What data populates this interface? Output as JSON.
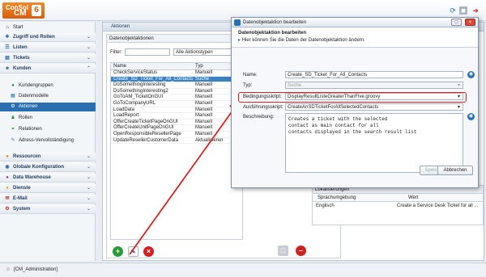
{
  "brand": {
    "line1": "ConSol",
    "line2": "CM",
    "version": "6"
  },
  "sidebar": {
    "start": "Start",
    "sections": [
      {
        "label": "Zugriff und Rollen"
      },
      {
        "label": "Listen"
      },
      {
        "label": "Tickets"
      },
      {
        "label": "Kunden"
      }
    ],
    "kunden_items": [
      "Kundengruppen",
      "Datenmodelle",
      "Aktionen",
      "Rollen",
      "Relationen",
      "Adress-Vervollständigung"
    ],
    "lower": [
      {
        "label": "Ressourcen"
      },
      {
        "label": "Globale Konfiguration"
      },
      {
        "label": "Data Warehouse"
      },
      {
        "label": "Dienste"
      },
      {
        "label": "E-Mail"
      },
      {
        "label": "System"
      }
    ]
  },
  "panel": {
    "title": "Aktionen",
    "inner_title": "Datenobjektaktionen",
    "filter_label": "Filter:",
    "filter_value": "",
    "type_select": "Alle Aktionstypen",
    "col_name": "Name",
    "col_typ": "Typ",
    "rows": [
      {
        "name": "CheckServiceStatus",
        "typ": "Manuell"
      },
      {
        "name": "Create_SD_Ticket_For_All_Contacts",
        "typ": "Suche"
      },
      {
        "name": "DoSomethingInteresting",
        "typ": "Manuell"
      },
      {
        "name": "DoSomethingInteresting2",
        "typ": "Manuell"
      },
      {
        "name": "GoToAM_TicketOnGUI",
        "typ": "Manuell"
      },
      {
        "name": "GoToCompanyURL",
        "typ": "Manuell"
      },
      {
        "name": "LoadData",
        "typ": "Manuell"
      },
      {
        "name": "LoadReport",
        "typ": "Manuell"
      },
      {
        "name": "OfferCreateTicketPageOnGUI",
        "typ": "Manuell"
      },
      {
        "name": "OfferCreateUnitPageOnGUI",
        "typ": "Manuell"
      },
      {
        "name": "OpenResponsibleResellerPage",
        "typ": "Manuell"
      },
      {
        "name": "UpdateResellerCustomerData",
        "typ": "Aktualisieren"
      }
    ],
    "selected_index": 1
  },
  "dialog": {
    "title": "Datenobjektaktion bearbeiten",
    "heading": "Datenobjektaktion bearbeiten",
    "info": "Hier können Sie die Daten der Datenobjektaktion ändern.",
    "name_label": "Name:",
    "name_value": "Create_SD_Ticket_For_All_Contacts",
    "typ_label": "Typ:",
    "typ_value": "Suche",
    "cond_label": "Bedingungsskript:",
    "cond_value": "DisplayResultListeGreaterThanFive.groovy",
    "exec_label": "Ausführungsskript:",
    "exec_value": "CreateAnSDTicketForAllSelectedContacts",
    "desc_label": "Beschreibung:",
    "desc_lines": [
      "Creates a ticket with the selected",
      "contact as main contact for all",
      "contacts displayed in the search result list"
    ],
    "save": "Speichern",
    "cancel": "Abbrechen"
  },
  "localization": {
    "title": "Lokalisierungen",
    "col1": "Sprachumgebung",
    "col2": "Wert",
    "row_lang": "Englisch",
    "row_value": "Create a Service Desk Ticket for all ..."
  },
  "status": {
    "user": "[CM_Administration]"
  },
  "colors": {
    "accent": "#2a6fb0",
    "brand": "#e2701c",
    "highlight": "#e02020"
  }
}
